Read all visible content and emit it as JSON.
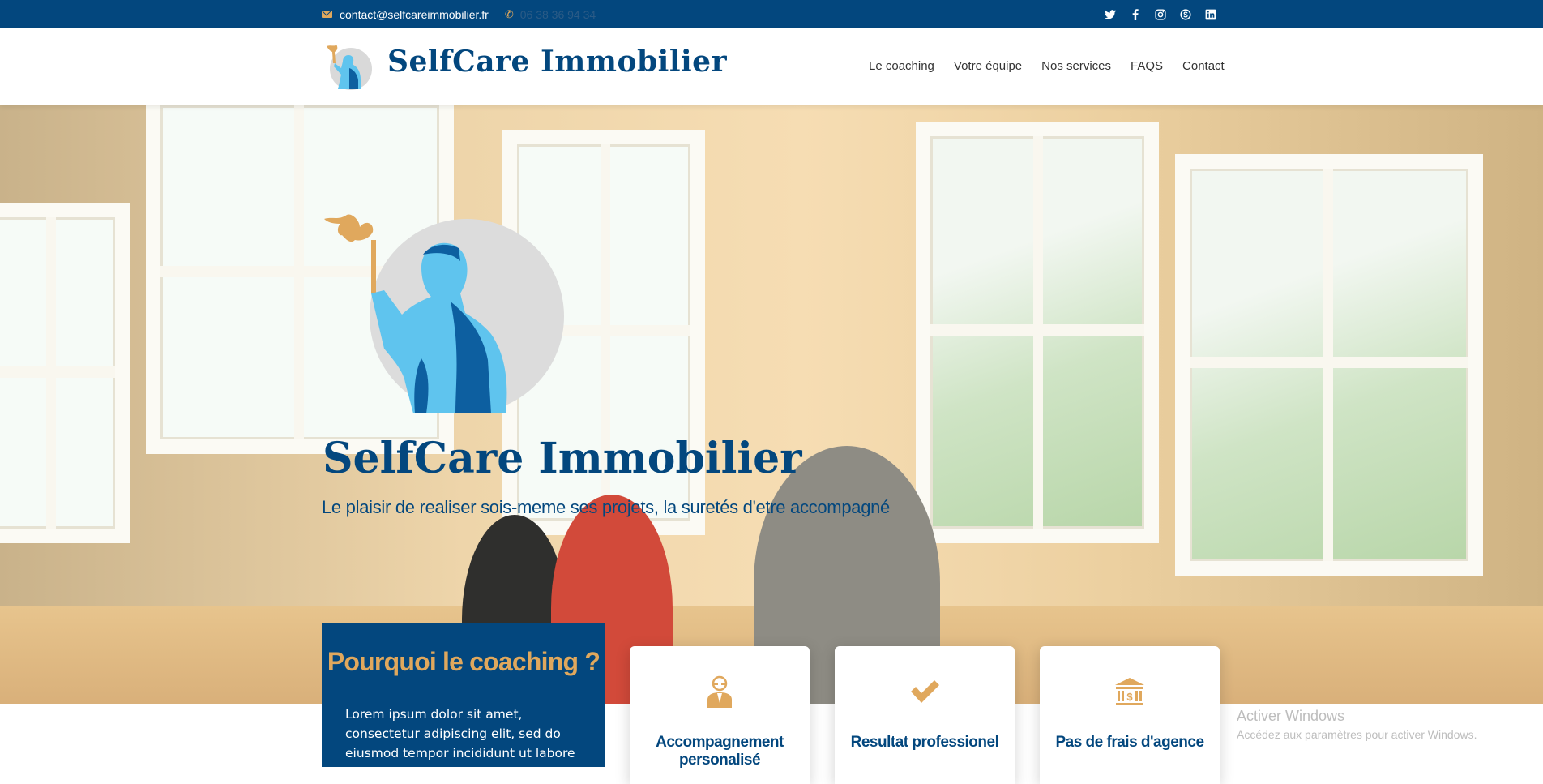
{
  "topbar": {
    "email": "contact@selfcareimmobilier.fr",
    "phone": "06 38 36 94 34",
    "icons": [
      "mail-icon",
      "phone-icon",
      "twitter-icon",
      "facebook-icon",
      "instagram-icon",
      "skype-icon",
      "linkedin-icon"
    ]
  },
  "header": {
    "brand": "SelfCare Immobilier",
    "nav": [
      "Le coaching",
      "Votre équipe",
      "Nos services",
      "FAQS",
      "Contact"
    ]
  },
  "hero": {
    "title": "SelfCare Immobilier",
    "subtitle": "Le plaisir de realiser sois-meme ses projets, la suretés d'etre accompagné"
  },
  "why": {
    "title": "Pourquoi le coaching ?",
    "text": "Lorem ipsum dolor sit amet, consectetur adipiscing elit, sed do eiusmod tempor incididunt ut labore et dolore magna"
  },
  "features": [
    {
      "icon": "advisor-icon",
      "label": "Accompagnement personalisé"
    },
    {
      "icon": "checkmark-icon",
      "label": "Resultat professionel"
    },
    {
      "icon": "bank-icon",
      "label": "Pas de frais d'agence"
    }
  ],
  "watermark": {
    "title": "Activer Windows",
    "subtitle": "Accédez aux paramètres pour activer Windows."
  },
  "colors": {
    "brand_blue": "#03477e",
    "accent_gold": "#e0a85d"
  }
}
